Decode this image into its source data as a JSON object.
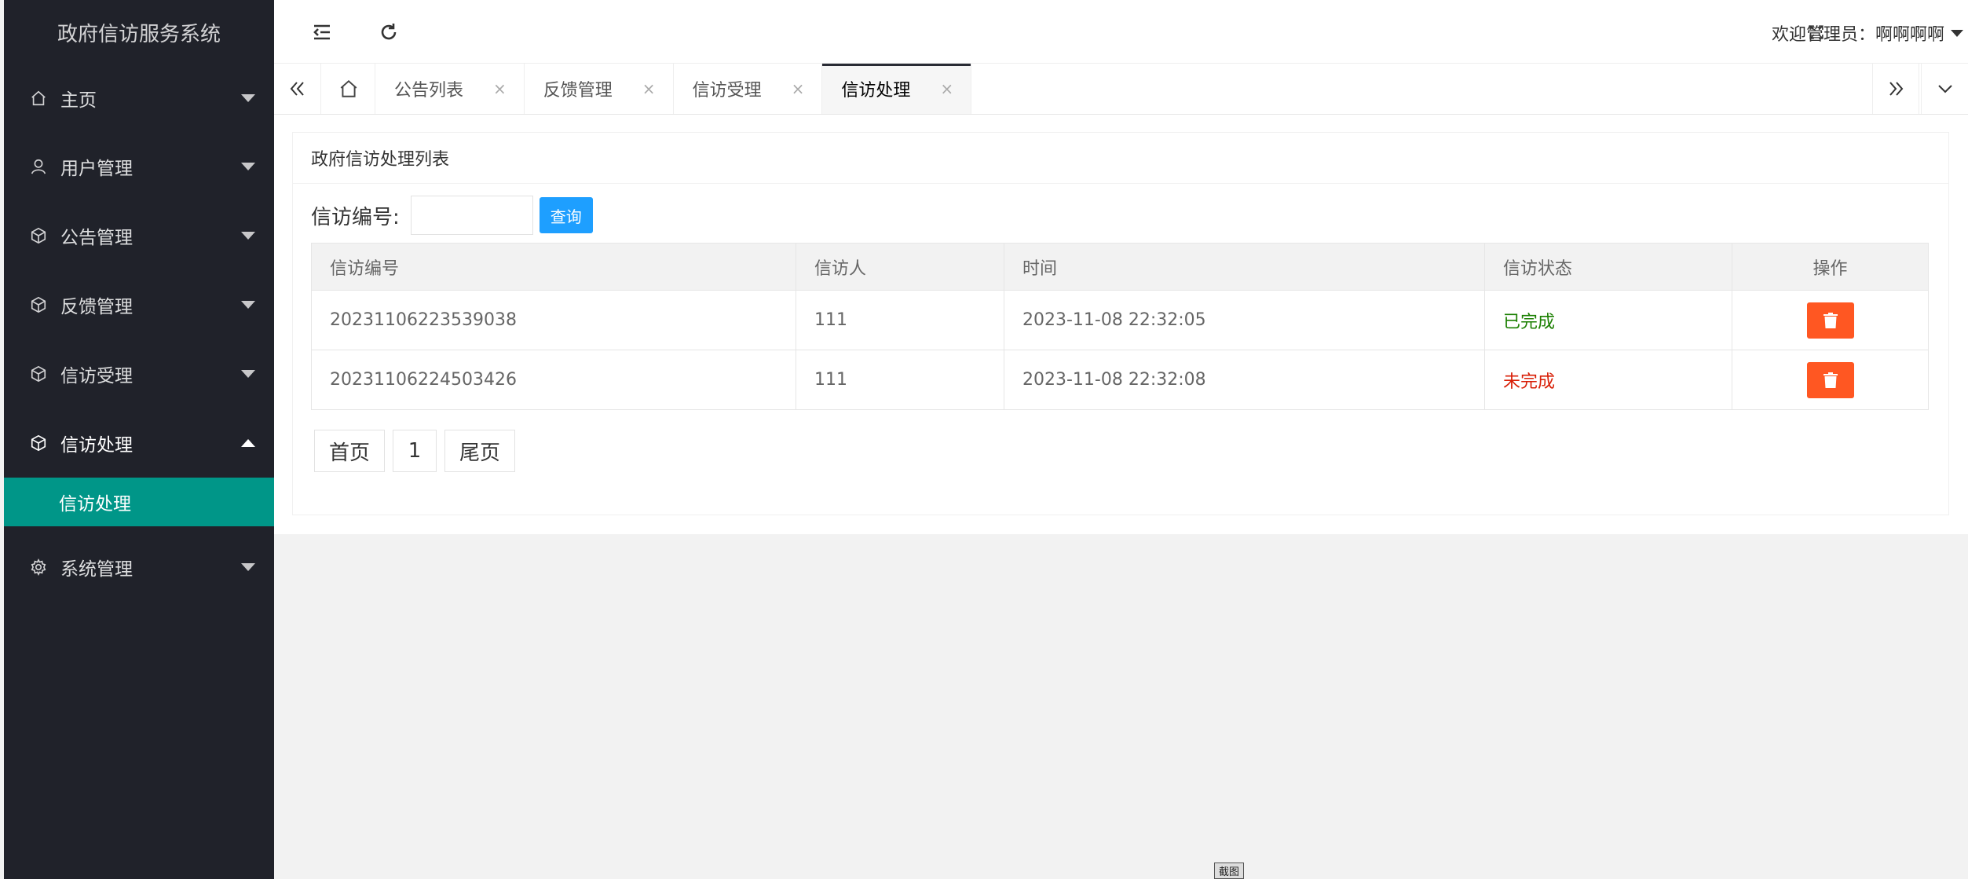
{
  "app": {
    "title": "政府信访服务系统"
  },
  "sidebar": {
    "items": [
      {
        "label": "主页",
        "icon": "home-icon",
        "expanded": false
      },
      {
        "label": "用户管理",
        "icon": "user-icon",
        "expanded": false
      },
      {
        "label": "公告管理",
        "icon": "cube-icon",
        "expanded": false
      },
      {
        "label": "反馈管理",
        "icon": "cube-icon",
        "expanded": false
      },
      {
        "label": "信访受理",
        "icon": "cube-icon",
        "expanded": false
      },
      {
        "label": "信访处理",
        "icon": "cube-icon",
        "expanded": true,
        "children": [
          {
            "label": "信访处理",
            "active": true
          }
        ]
      },
      {
        "label": "系统管理",
        "icon": "gear-icon",
        "expanded": false
      }
    ]
  },
  "header": {
    "welcome": "欢迎管理员：啊啊啊啊"
  },
  "tabs": [
    {
      "label": "公告列表",
      "close": "×"
    },
    {
      "label": "反馈管理",
      "close": "×"
    },
    {
      "label": "信访受理",
      "close": "×"
    },
    {
      "label": "信访处理",
      "close": "×",
      "active": true
    }
  ],
  "main": {
    "card_title": "政府信访处理列表",
    "search": {
      "label": "信访编号:",
      "value": "",
      "button": "查询"
    },
    "table": {
      "columns": [
        "信访编号",
        "信访人",
        "时间",
        "信访状态",
        "操作"
      ],
      "rows": [
        {
          "id": "20231106223539038",
          "person": "111",
          "time": "2023-11-08 22:32:05",
          "status": "已完成"
        },
        {
          "id": "20231106224503426",
          "person": "111",
          "time": "2023-11-08 22:32:08",
          "status": "未完成"
        }
      ]
    },
    "pager": {
      "first": "首页",
      "page": "1",
      "last": "尾页"
    }
  },
  "overlay": {
    "capture_label": "截图"
  },
  "colors": {
    "sidebar_bg": "#20222a",
    "active_green": "#009688",
    "primary_blue": "#1e9fff",
    "danger": "#ff5722",
    "status_done": "#1a7f00",
    "status_todo": "#d81e06"
  }
}
